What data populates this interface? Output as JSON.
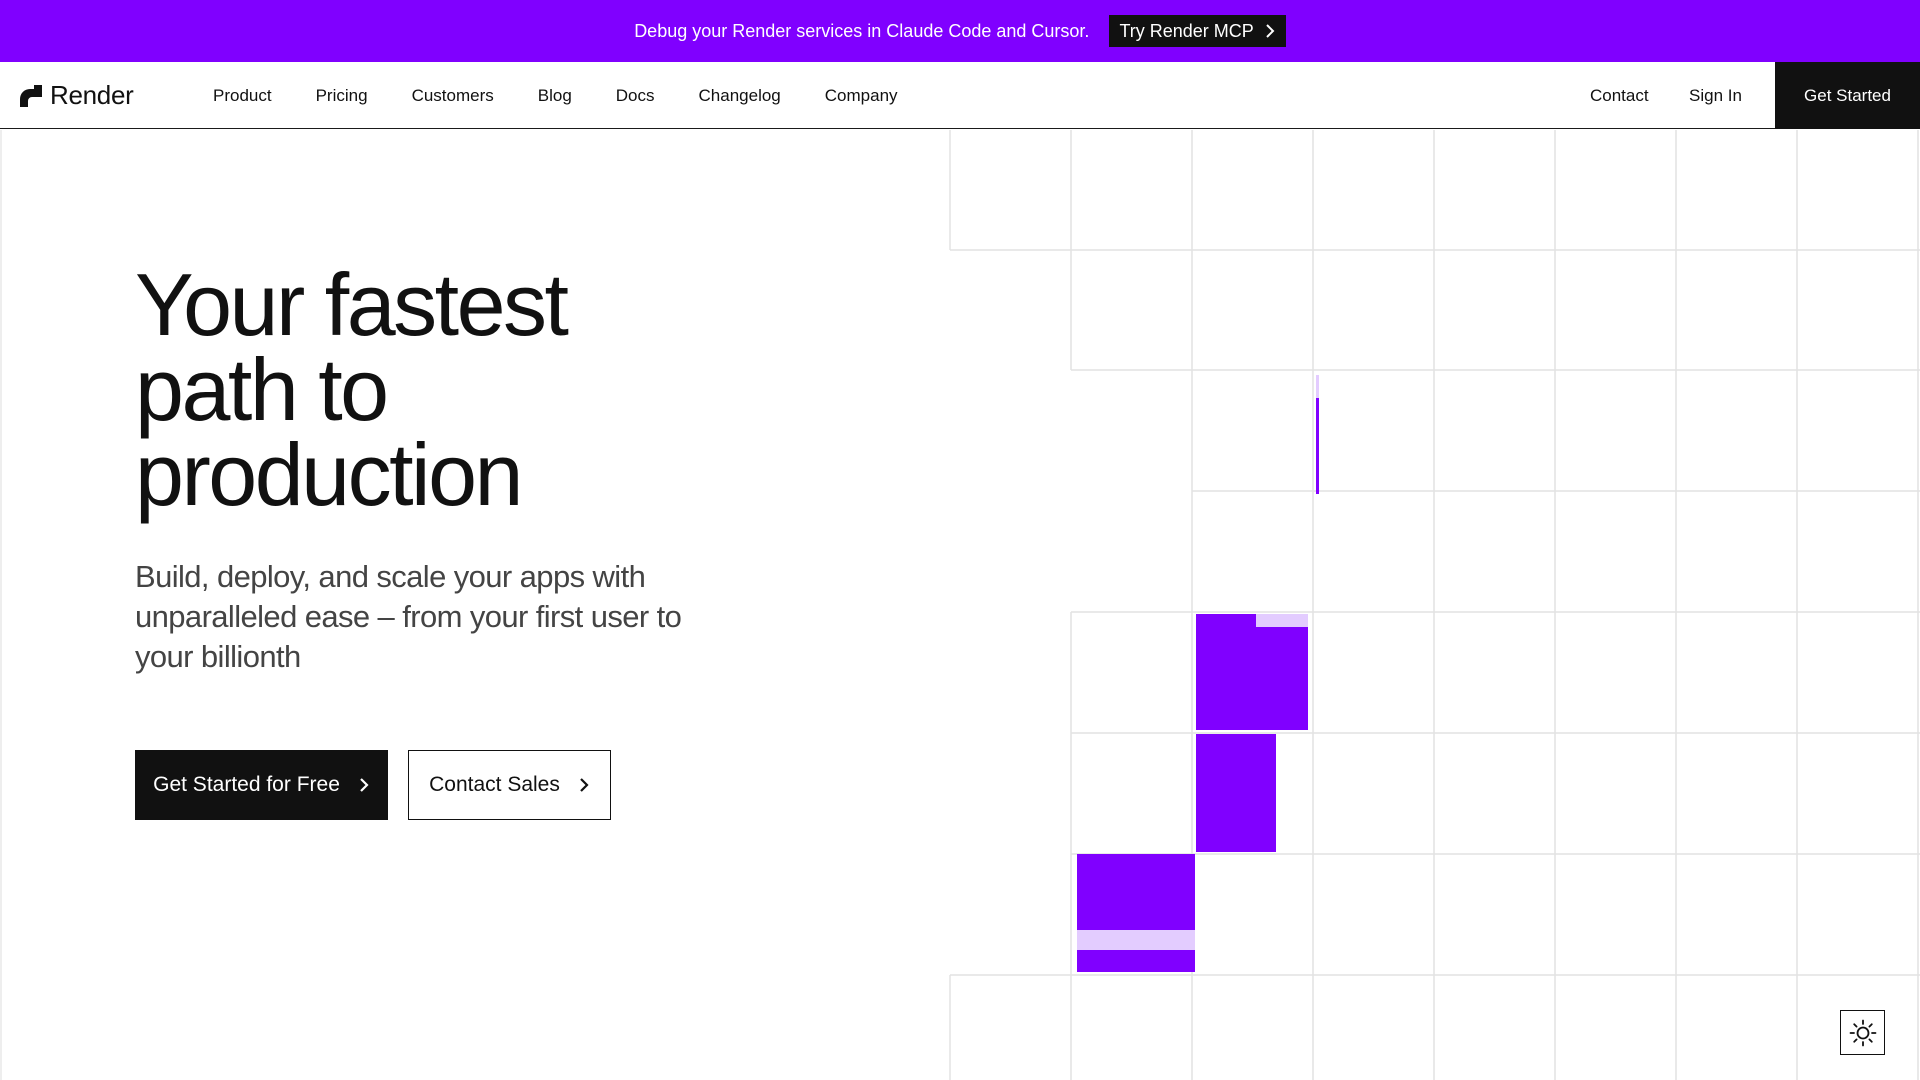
{
  "banner": {
    "text": "Debug your Render services in Claude Code and Cursor.",
    "cta_label": "Try Render MCP",
    "background": "#8000ff"
  },
  "header": {
    "logo_text": "Render",
    "nav": [
      {
        "label": "Product"
      },
      {
        "label": "Pricing"
      },
      {
        "label": "Customers"
      },
      {
        "label": "Blog"
      },
      {
        "label": "Docs"
      },
      {
        "label": "Changelog"
      },
      {
        "label": "Company"
      }
    ],
    "contact_label": "Contact",
    "sign_in_label": "Sign In",
    "get_started_label": "Get Started"
  },
  "hero": {
    "title_lines": [
      "Your fastest",
      "path to",
      "production"
    ],
    "subtitle": "Build, deploy, and scale your apps with unparalleled ease – from your first user to your billionth",
    "primary_button": "Get Started for Free",
    "secondary_button": "Contact Sales"
  },
  "theme": {
    "accent": "#8000ff",
    "accent_light": "#e3ccff",
    "icon": "sun-icon"
  }
}
